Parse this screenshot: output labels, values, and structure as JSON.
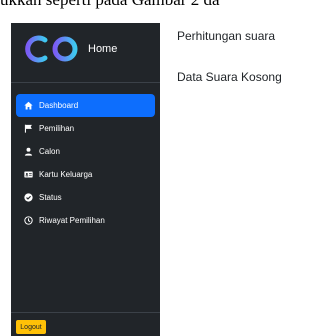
{
  "caption": "ukkan seperti pada Gambar 2 da",
  "sidebar": {
    "brand_title": "Home",
    "logo_icon": "cp-logo-icon",
    "items": [
      {
        "label": "Dashboard",
        "icon": "home-icon",
        "active": true
      },
      {
        "label": "Pemilihan",
        "icon": "flag-icon",
        "active": false
      },
      {
        "label": "Calon",
        "icon": "person-icon",
        "active": false
      },
      {
        "label": "Kartu Keluarga",
        "icon": "id-card-icon",
        "active": false
      },
      {
        "label": "Status",
        "icon": "check-circle-icon",
        "active": false
      },
      {
        "label": "Riwayat Pemilihan",
        "icon": "clock-icon",
        "active": false
      }
    ],
    "logout_label": "Logout"
  },
  "main": {
    "title": "Perhitungan suara",
    "empty_message": "Data Suara Kosong"
  },
  "colors": {
    "sidebar_bg": "#212529",
    "active_bg": "#0d6efd",
    "logout_bg": "#ffc107",
    "logo_gradient_start": "#7b5cf5",
    "logo_gradient_end": "#3ec9f0"
  }
}
